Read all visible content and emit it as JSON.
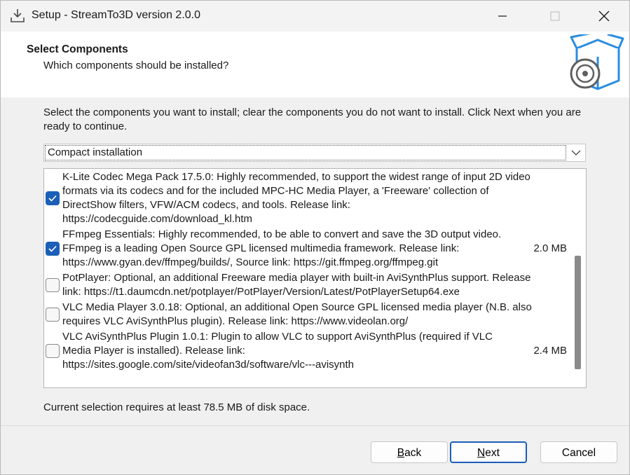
{
  "window": {
    "title": "Setup - StreamTo3D version 2.0.0"
  },
  "header": {
    "title": "Select Components",
    "subtitle": "Which components should be installed?"
  },
  "instruction": "Select the components you want to install; clear the components you do not want to install. Click Next when you are ready to continue.",
  "setup_type": {
    "selected": "Compact installation"
  },
  "components": [
    {
      "checked": true,
      "lines": [
        "K-Lite Codec Mega Pack 17.5.0: Highly recommended, to support the widest range of input 2D video",
        "formats via its codecs and for the included MPC-HC Media Player, a 'Freeware' collection of",
        "DirectShow filters, VFW/ACM codecs, and tools. Release link:",
        "https://codecguide.com/download_kl.htm"
      ],
      "size": ""
    },
    {
      "checked": true,
      "lines": [
        "FFmpeg Essentials: Highly recommended, to be able to convert and save the 3D output video.",
        "FFmpeg is a leading Open Source GPL licensed multimedia framework. Release link:",
        "https://www.gyan.dev/ffmpeg/builds/, Source link: https://git.ffmpeg.org/ffmpeg.git"
      ],
      "size": "2.0 MB"
    },
    {
      "checked": false,
      "lines": [
        "PotPlayer: Optional, an additional Freeware media player with built-in AviSynthPlus support. Release",
        "link: https://t1.daumcdn.net/potplayer/PotPlayer/Version/Latest/PotPlayerSetup64.exe"
      ],
      "size": ""
    },
    {
      "checked": false,
      "lines": [
        "VLC Media Player 3.0.18: Optional, an additional Open Source GPL licensed media player (N.B. also",
        "requires VLC AviSynthPlus plugin). Release link: https://www.videolan.org/"
      ],
      "size": ""
    },
    {
      "checked": false,
      "lines": [
        "VLC AviSynthPlus Plugin 1.0.1: Plugin to allow VLC to support AviSynthPlus (required if VLC",
        "Media Player is installed). Release link:",
        "https://sites.google.com/site/videofan3d/software/vlc---avisynth"
      ],
      "size": "2.4 MB"
    }
  ],
  "disk_space": "Current selection requires at least 78.5 MB of disk space.",
  "buttons": {
    "back": {
      "accel": "B",
      "rest": "ack"
    },
    "next": {
      "accel": "N",
      "rest": "ext"
    },
    "cancel": "Cancel"
  },
  "icons": {
    "app": "setup-download-icon",
    "header": "box-disc-icon",
    "check": "checkmark-icon",
    "dropdown": "chevron-down-icon"
  },
  "colors": {
    "accent": "#1b5fb8",
    "header_bg": "#ffffff",
    "body_bg": "#f0f0f0"
  }
}
